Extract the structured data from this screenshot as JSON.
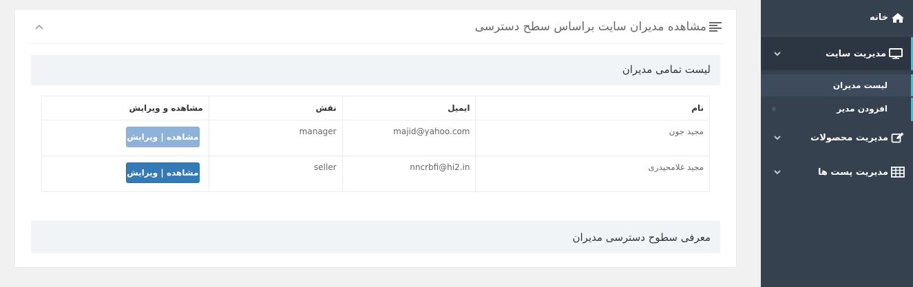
{
  "sidebar": {
    "items": [
      {
        "label": "خانه",
        "icon": "home-icon"
      },
      {
        "label": "مدیریت سایت",
        "icon": "monitor-icon"
      },
      {
        "label": "مدیریت محصولات",
        "icon": "edit-icon"
      },
      {
        "label": "مدیریت پست ها",
        "icon": "table-icon"
      }
    ],
    "sub_items": [
      {
        "label": "لیست مدیران"
      },
      {
        "label": "افزودن مدیر"
      }
    ],
    "accent_color": "#36c6d3"
  },
  "portlet": {
    "title": "مشاهده مدیران سایت براساس سطح دسترسی",
    "list_heading": "لیست تمامی مدیران",
    "levels_heading": "معرفی سطوح دسترسی مدیران"
  },
  "table": {
    "headers": [
      "نام",
      "ایمیل",
      "نقش",
      "مشاهده و ویرایش"
    ],
    "rows": [
      {
        "name": "مجید جون",
        "email": "majid@yahoo.com",
        "role": "manager",
        "action": "مشاهده | ویرایش"
      },
      {
        "name": "مجید غلامحیدری",
        "email": "nncrbfi@hi2.in",
        "role": "seller",
        "action": "مشاهده | ویرایش"
      }
    ]
  }
}
